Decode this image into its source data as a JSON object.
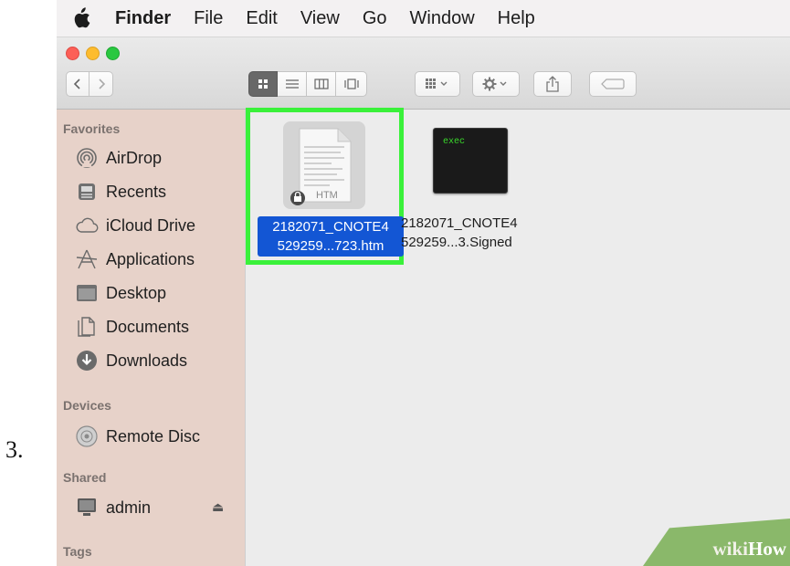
{
  "step_number": "3.",
  "menubar": {
    "app": "Finder",
    "items": [
      "File",
      "Edit",
      "View",
      "Go",
      "Window",
      "Help"
    ]
  },
  "sidebar": {
    "favorites_heading": "Favorites",
    "favorites": [
      {
        "label": "AirDrop",
        "icon": "airdrop-icon"
      },
      {
        "label": "Recents",
        "icon": "recents-icon"
      },
      {
        "label": "iCloud Drive",
        "icon": "cloud-icon"
      },
      {
        "label": "Applications",
        "icon": "applications-icon"
      },
      {
        "label": "Desktop",
        "icon": "desktop-icon"
      },
      {
        "label": "Documents",
        "icon": "documents-icon"
      },
      {
        "label": "Downloads",
        "icon": "downloads-icon"
      }
    ],
    "devices_heading": "Devices",
    "devices": [
      {
        "label": "Remote Disc",
        "icon": "disc-icon"
      }
    ],
    "shared_heading": "Shared",
    "shared": [
      {
        "label": "admin",
        "icon": "computer-icon"
      }
    ],
    "tags_heading": "Tags"
  },
  "files": [
    {
      "line1": "2182071_CNOTE4",
      "line2": "529259...723.htm",
      "icon_text": "HTM",
      "selected": true
    },
    {
      "line1": "2182071_CNOTE4",
      "line2": "529259...3.Signed",
      "icon_text": "exec",
      "selected": false
    }
  ],
  "watermark": {
    "part1": "wiki",
    "part2": "How"
  },
  "colors": {
    "selection": "#1356d4",
    "highlight_box": "#3af13a",
    "sidebar": "#e7d2c9",
    "watermark": "#8ab86a"
  }
}
